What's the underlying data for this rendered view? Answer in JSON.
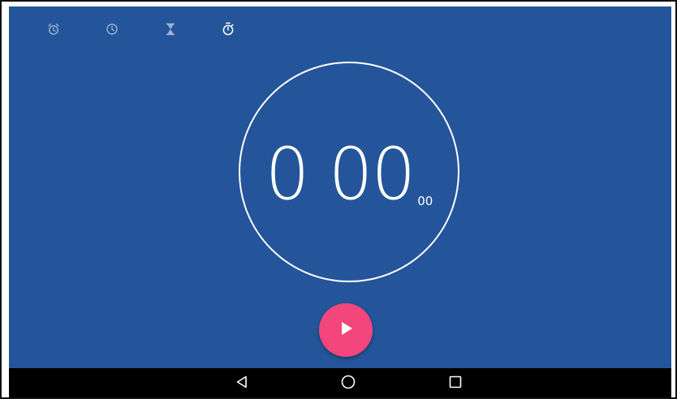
{
  "tabs": [
    {
      "icon": "alarm-icon",
      "active": false
    },
    {
      "icon": "clock-icon",
      "active": false
    },
    {
      "icon": "hourglass-icon",
      "active": false
    },
    {
      "icon": "stopwatch-icon",
      "active": true
    }
  ],
  "stopwatch": {
    "main": "0 00",
    "hundredths": "00"
  },
  "fab": {
    "icon": "play-icon"
  },
  "navbar": {
    "back_icon": "back-icon",
    "home_icon": "home-icon",
    "recents_icon": "recents-icon"
  },
  "colors": {
    "background": "#24559a",
    "accent": "#f2467d",
    "navbar": "#000000",
    "foreground": "#ffffff"
  }
}
